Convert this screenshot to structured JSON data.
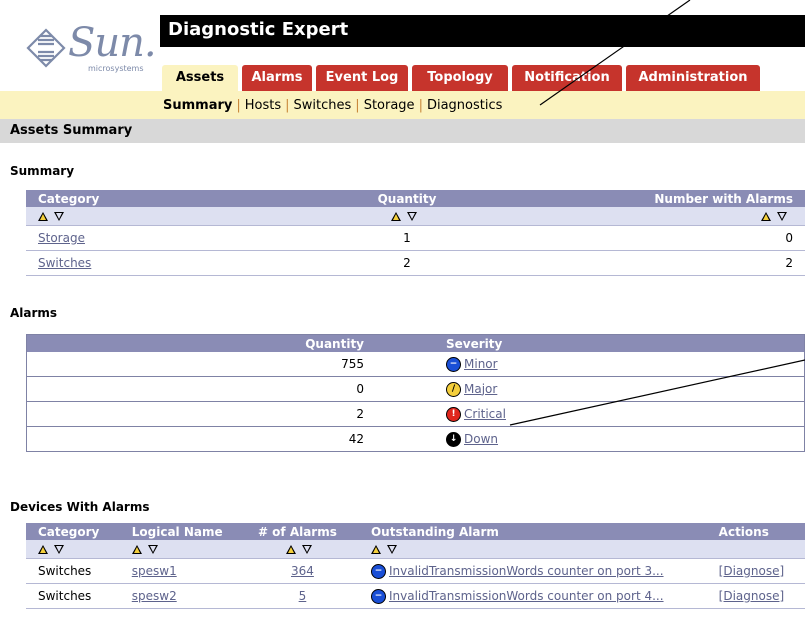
{
  "app": {
    "title": "Diagnostic Expert",
    "logo_text": "Sun.",
    "logo_sub": "microsystems"
  },
  "tabs": [
    "Assets",
    "Alarms",
    "Event Log",
    "Topology",
    "Notification",
    "Administration"
  ],
  "subnav": {
    "items": [
      "Summary",
      "Hosts",
      "Switches",
      "Storage",
      "Diagnostics"
    ],
    "separator": "|"
  },
  "page_title": "Assets Summary",
  "summary": {
    "heading": "Summary",
    "columns": [
      "Category",
      "Quantity",
      "Number with Alarms"
    ],
    "rows": [
      {
        "category": "Storage",
        "quantity": "1",
        "alarms": "0"
      },
      {
        "category": "Switches",
        "quantity": "2",
        "alarms": "2"
      }
    ]
  },
  "alarms": {
    "heading": "Alarms",
    "columns": [
      "Quantity",
      "Severity"
    ],
    "rows": [
      {
        "quantity": "755",
        "severity": "Minor",
        "icon": "minor-icon",
        "color": "#1a4fd6"
      },
      {
        "quantity": "0",
        "severity": "Major",
        "icon": "major-icon",
        "color": "#f4cf3c"
      },
      {
        "quantity": "2",
        "severity": "Critical",
        "icon": "critical-icon",
        "color": "#e0261d"
      },
      {
        "quantity": "42",
        "severity": "Down",
        "icon": "down-icon",
        "color": "#000000"
      }
    ]
  },
  "devices": {
    "heading": "Devices With Alarms",
    "columns": [
      "Category",
      "Logical Name",
      "# of Alarms",
      "Outstanding Alarm",
      "Actions"
    ],
    "rows": [
      {
        "category": "Switches",
        "name": "spesw1",
        "count": "364",
        "alarm": "InvalidTransmissionWords counter on port 3...",
        "action": "[Diagnose]"
      },
      {
        "category": "Switches",
        "name": "spesw2",
        "count": "5",
        "alarm": "InvalidTransmissionWords counter on port 4...",
        "action": "[Diagnose]"
      }
    ]
  },
  "colors": {
    "accent_red": "#c6342c",
    "subnav_bg": "#fbf3c0",
    "table_header": "#8a8cb5"
  }
}
